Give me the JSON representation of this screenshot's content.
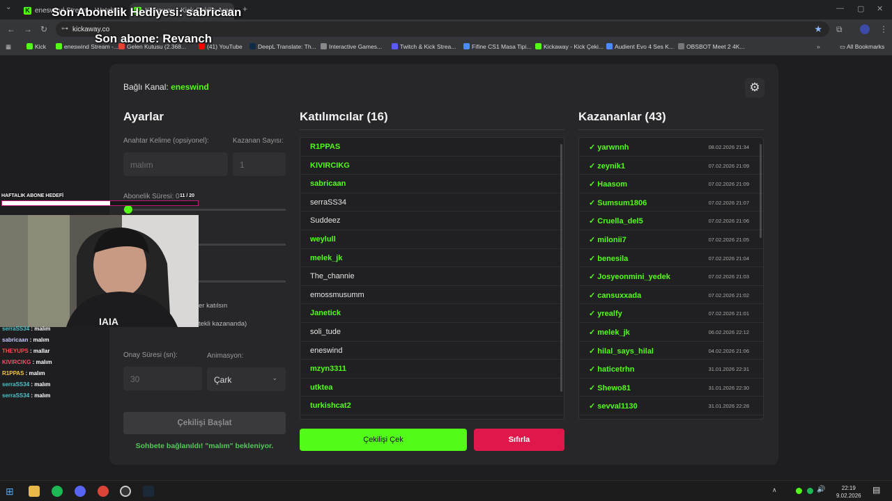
{
  "browser": {
    "tabs": [
      {
        "label": "eneswind Stream - Watch Live"
      },
      {
        "label": "Kickaway - Kick Çekiliş Aracı"
      }
    ],
    "url": "kickaway.co",
    "bookmarks": [
      "Kick",
      "eneswind Stream -...",
      "Gelen Kutusu (2.368...",
      "(41) YouTube",
      "DeepL Translate: Th...",
      "Interactive Games...",
      "Twitch & Kick Strea...",
      "Fifine CS1 Masa Tipi...",
      "Kickaway - Kick Çeki...",
      "Audient Evo 4 Ses K...",
      "OBSBOT Meet 2 4K..."
    ],
    "all_bookmarks": "All Bookmarks"
  },
  "stream_overlay": {
    "gift_line": "Son Abonelik Hediyesi: sabricaan",
    "sub_line": "Son abone: Revanch",
    "goal_label": "HAFTALIK ABONE HEDEFİ",
    "goal_count": "11 / 20",
    "goal_progress": 0.55,
    "chat": [
      {
        "user": "serraSS34",
        "msg": ": malım",
        "color": "#4fc3c8"
      },
      {
        "user": "sabricaan",
        "msg": ": malım",
        "color": "#c9c9ff"
      },
      {
        "user": "THEYUPS",
        "msg": ": mallar",
        "color": "#ff4a4a"
      },
      {
        "user": "KIVIRCIKG",
        "msg": ": malım",
        "color": "#ff4a6a"
      },
      {
        "user": "R1PPAS",
        "msg": ": malım",
        "color": "#f5c542"
      },
      {
        "user": "serraSS34",
        "msg": ": malım",
        "color": "#4fc3c8"
      },
      {
        "user": "serraSS34",
        "msg": ": malım",
        "color": "#4fc3c8"
      }
    ]
  },
  "app": {
    "connected_label": "Bağlı Kanal:",
    "connected_channel": "eneswind",
    "settings": {
      "title": "Ayarlar",
      "keyword_label": "Anahtar Kelime (opsiyonel):",
      "keyword_placeholder": "malım",
      "winner_count_label": "Kazanan Sayısı:",
      "winner_count_placeholder": "1",
      "sub_duration_label": "Abonelik Süresi: 0",
      "partial_text_1": "er katılsın",
      "partial_text_2": "tekli kazananda)",
      "confirm_label": "Onay Süresi (sn):",
      "confirm_placeholder": "30",
      "animation_label": "Animasyon:",
      "animation_value": "Çark",
      "start_button": "Çekilişi Başlat",
      "status": "Sohbete bağlanıldı! \"malım\" bekleniyor."
    },
    "participants": {
      "title": "Katılımcılar (16)",
      "items": [
        {
          "name": "R1PPAS",
          "highlight": true
        },
        {
          "name": "KIVIRCIKG",
          "highlight": true
        },
        {
          "name": "sabricaan",
          "highlight": true
        },
        {
          "name": "serraSS34",
          "highlight": false
        },
        {
          "name": "Suddeez",
          "highlight": false
        },
        {
          "name": "weylull",
          "highlight": true
        },
        {
          "name": "melek_jk",
          "highlight": true
        },
        {
          "name": "The_channie",
          "highlight": false
        },
        {
          "name": "emossmusumm",
          "highlight": false
        },
        {
          "name": "Janetick",
          "highlight": true
        },
        {
          "name": "soli_tude",
          "highlight": false
        },
        {
          "name": "eneswind",
          "highlight": false
        },
        {
          "name": "mzyn3311",
          "highlight": true
        },
        {
          "name": "utktea",
          "highlight": true
        },
        {
          "name": "turkishcat2",
          "highlight": true
        }
      ]
    },
    "winners": {
      "title": "Kazananlar (43)",
      "items": [
        {
          "name": "✓ yarwnnh",
          "date": "08.02.2026 21:34"
        },
        {
          "name": "✓ zeynik1",
          "date": "07.02.2026 21:09"
        },
        {
          "name": "✓ Haasom",
          "date": "07.02.2026 21:09"
        },
        {
          "name": "✓ Sumsum1806",
          "date": "07.02.2026 21:07"
        },
        {
          "name": "✓ Cruella_del5",
          "date": "07.02.2026 21:06"
        },
        {
          "name": "✓ milonii7",
          "date": "07.02.2026 21:05"
        },
        {
          "name": "✓ benesila",
          "date": "07.02.2026 21:04"
        },
        {
          "name": "✓ Josyeonmini_yedek",
          "date": "07.02.2026 21:03"
        },
        {
          "name": "✓ cansuxxada",
          "date": "07.02.2026 21:02"
        },
        {
          "name": "✓ yrealfy",
          "date": "07.02.2026 21:01"
        },
        {
          "name": "✓ melek_jk",
          "date": "06.02.2026 22:12"
        },
        {
          "name": "✓ hilal_says_hilal",
          "date": "04.02.2026 21:06"
        },
        {
          "name": "✓ haticetrhn",
          "date": "31.01.2026 22:31"
        },
        {
          "name": "✓ Shewo81",
          "date": "31.01.2026 22:30"
        },
        {
          "name": "✓ sevval1130",
          "date": "31.01.2026 22:28"
        }
      ]
    },
    "draw_button": "Çekilişi Çek",
    "reset_button": "Sıfırla"
  },
  "taskbar": {
    "time": "22:19",
    "date": "9.02.2026"
  },
  "colors": {
    "accent": "#53fc18",
    "danger": "#e0174a",
    "card": "#27272a"
  }
}
